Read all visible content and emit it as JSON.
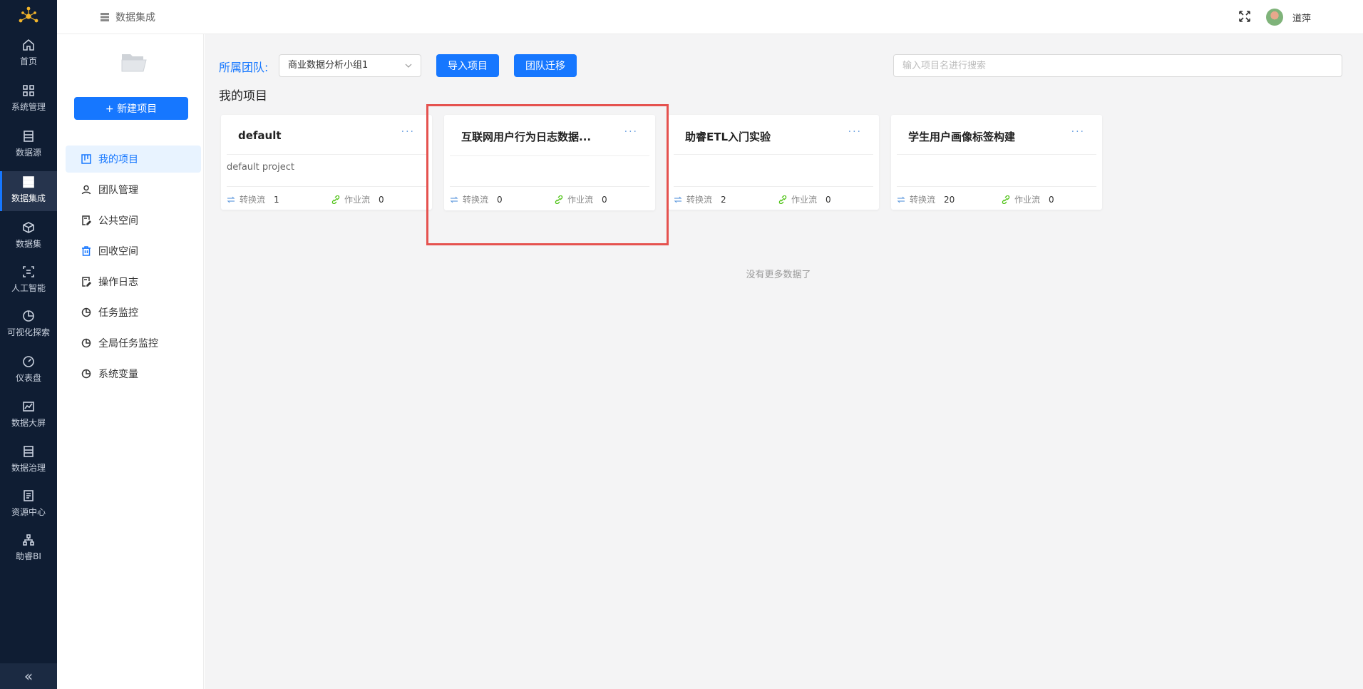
{
  "rail": {
    "items": [
      {
        "label": "首页",
        "icon": "home-icon"
      },
      {
        "label": "系统管理",
        "icon": "grid-icon"
      },
      {
        "label": "数据源",
        "icon": "doc-icon"
      },
      {
        "label": "数据集成",
        "icon": "server-icon",
        "active": true
      },
      {
        "label": "数据集",
        "icon": "cube-icon"
      },
      {
        "label": "人工智能",
        "icon": "ai-icon"
      },
      {
        "label": "可视化探索",
        "icon": "pie-icon"
      },
      {
        "label": "仪表盘",
        "icon": "gauge-icon"
      },
      {
        "label": "数据大屏",
        "icon": "chart-icon"
      },
      {
        "label": "数据治理",
        "icon": "list-icon"
      },
      {
        "label": "资源中心",
        "icon": "file-icon"
      },
      {
        "label": "助睿BI",
        "icon": "org-icon"
      }
    ],
    "collapse": "«"
  },
  "header": {
    "breadcrumb": "数据集成",
    "user": "道萍"
  },
  "side": {
    "new_button": "+ 新建项目",
    "menu": [
      {
        "label": "我的项目",
        "active": true
      },
      {
        "label": "团队管理"
      },
      {
        "label": "公共空间"
      },
      {
        "label": "回收空间"
      },
      {
        "label": "操作日志"
      },
      {
        "label": "任务监控"
      },
      {
        "label": "全局任务监控"
      },
      {
        "label": "系统变量"
      }
    ]
  },
  "toolbar": {
    "team_label": "所属团队:",
    "team_value": "商业数据分析小组1",
    "import_button": "导入项目",
    "migrate_button": "团队迁移",
    "search_placeholder": "输入项目名进行搜索"
  },
  "section_title": "我的项目",
  "cards": [
    {
      "title": "default",
      "desc": "default project",
      "transform_label": "转换流",
      "transform_count": "1",
      "job_label": "作业流",
      "job_count": "0"
    },
    {
      "title": "互联网用户行为日志数据...",
      "desc": "",
      "transform_label": "转换流",
      "transform_count": "0",
      "job_label": "作业流",
      "job_count": "0"
    },
    {
      "title": "助睿ETL入门实验",
      "desc": "",
      "transform_label": "转换流",
      "transform_count": "2",
      "job_label": "作业流",
      "job_count": "0"
    },
    {
      "title": "学生用户画像标签构建",
      "desc": "",
      "transform_label": "转换流",
      "transform_count": "20",
      "job_label": "作业流",
      "job_count": "0"
    }
  ],
  "more_dots": "···",
  "no_more": "没有更多数据了",
  "colors": {
    "primary": "#1677ff",
    "rail_bg": "#0f1d33",
    "highlight": "#e5524f"
  }
}
